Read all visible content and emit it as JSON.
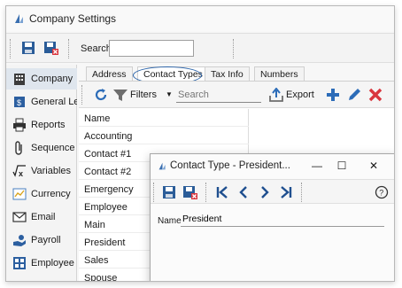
{
  "window": {
    "title": "Company Settings"
  },
  "toolbar": {
    "search_label": "Search",
    "search_value": ""
  },
  "sidebar": {
    "items": [
      {
        "label": "Company",
        "icon": "building-icon"
      },
      {
        "label": "General Le",
        "icon": "ledger-icon"
      },
      {
        "label": "Reports",
        "icon": "printer-icon"
      },
      {
        "label": "Sequence",
        "icon": "paperclip-icon"
      },
      {
        "label": "Variables",
        "icon": "variable-x-icon"
      },
      {
        "label": "Currency",
        "icon": "chart-icon"
      },
      {
        "label": "Email",
        "icon": "envelope-icon"
      },
      {
        "label": "Payroll",
        "icon": "hand-money-icon"
      },
      {
        "label": "Employee",
        "icon": "grid-icon"
      }
    ]
  },
  "tabs": [
    "Address",
    "Contact Types",
    "Tax Info",
    "Numbers"
  ],
  "list_toolbar": {
    "filters_label": "Filters",
    "search_placeholder": "Search",
    "export_label": "Export"
  },
  "list": {
    "header": "Name",
    "rows": [
      "Accounting",
      "Contact #1",
      "Contact #2",
      "Emergency",
      "Employee",
      "Main",
      "President",
      "Sales",
      "Spouse"
    ]
  },
  "dialog": {
    "title": "Contact Type - President...",
    "controls": {
      "minimize": "—",
      "maximize": "☐",
      "close": "✕"
    },
    "help": "?",
    "field_label": "Name",
    "field_value": "President"
  },
  "colors": {
    "accent": "#2a63a9",
    "delete": "#d9363e",
    "nav": "#1f4f8f"
  }
}
